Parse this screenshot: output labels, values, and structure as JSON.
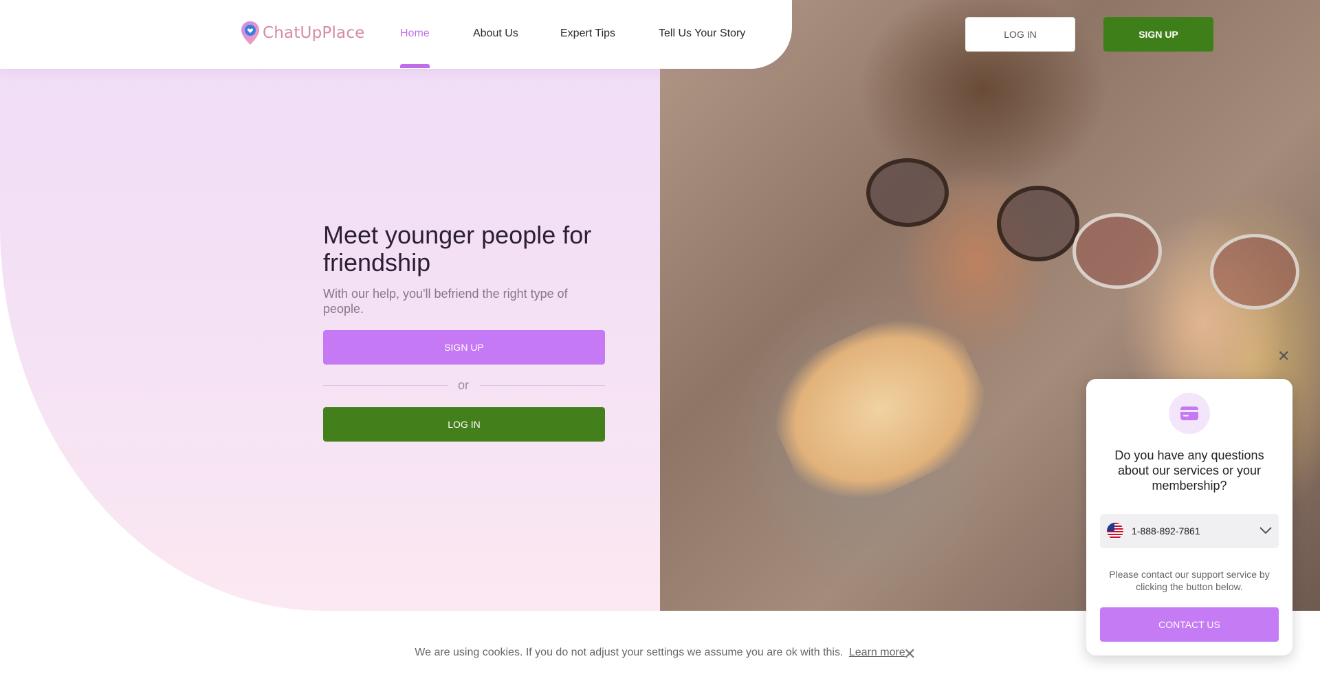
{
  "header": {
    "logo_text": "ChatUpPlace",
    "nav": [
      {
        "label": "Home",
        "active": true
      },
      {
        "label": "About Us"
      },
      {
        "label": "Expert Tips"
      },
      {
        "label": "Tell Us Your Story"
      }
    ],
    "login_label": "LOG IN",
    "signup_label": "SIGN UP"
  },
  "hero": {
    "title": "Meet younger people for friendship",
    "subtitle": "With our help, you'll befriend the right type of people.",
    "signup_label": "SIGN UP",
    "or_text": "or",
    "login_label": "LOG IN"
  },
  "support_popup": {
    "icon": "credit-card-icon",
    "question": "Do you have any questions about our services or your membership?",
    "phone": "1-888-892-7861",
    "phone_country": "us-flag-icon",
    "note": "Please contact our support service by clicking the button below.",
    "contact_label": "CONTACT US"
  },
  "cookie_bar": {
    "text": "We are using cookies. If you do not adjust your settings we assume you are ok with this.",
    "link": "Learn more"
  },
  "colors": {
    "accent_purple": "#c679f4",
    "accent_green": "#43801c",
    "hero_bg": "#f0dcf8"
  }
}
